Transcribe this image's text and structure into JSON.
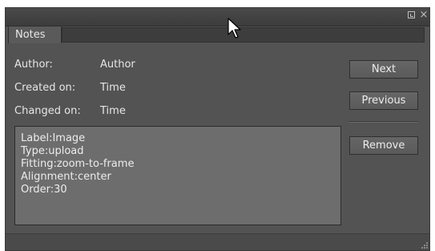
{
  "panel": {
    "tab_label": "Notes",
    "window_buttons": {
      "restore_icon": "restore-icon",
      "close_symbol": "×"
    }
  },
  "fields": {
    "author_label": "Author:",
    "author_value": "Author",
    "created_label": "Created on:",
    "created_value": "Time",
    "changed_label": "Changed on:",
    "changed_value": "Time"
  },
  "info": {
    "lines": [
      "Label:Image",
      "Type:upload",
      "Fitting:zoom-to-frame",
      "Alignment:center",
      "Order:30"
    ]
  },
  "buttons": {
    "next_label": "Next",
    "previous_label": "Previous",
    "remove_label": "Remove"
  },
  "colors": {
    "panel_bg": "#535353",
    "info_bg": "#6d6d6d",
    "text": "#e6e6e6"
  }
}
